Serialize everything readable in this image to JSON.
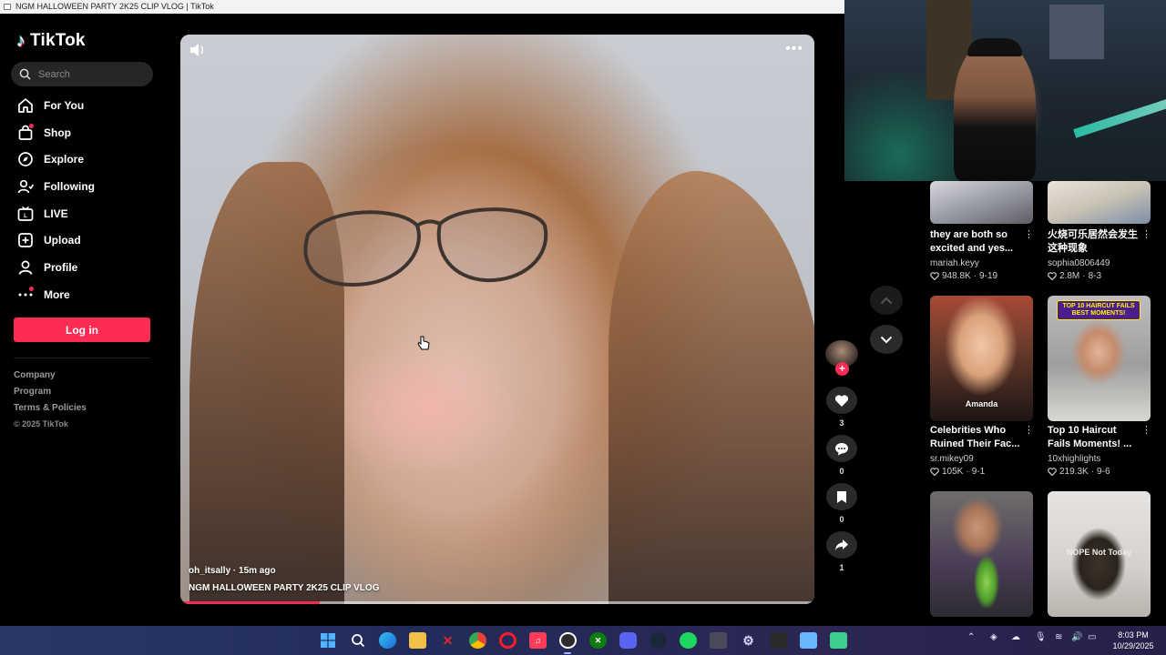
{
  "window": {
    "title": "NGM HALLOWEEN PARTY 2K25 CLIP VLOG | TikTok"
  },
  "brand": {
    "name": "TikTok",
    "accent": "#fe2c55"
  },
  "search": {
    "placeholder": "Search",
    "icon": "search-icon"
  },
  "nav": [
    {
      "label": "For You",
      "icon": "home-icon"
    },
    {
      "label": "Shop",
      "icon": "shop-bag-icon"
    },
    {
      "label": "Explore",
      "icon": "compass-icon"
    },
    {
      "label": "Following",
      "icon": "following-icon"
    },
    {
      "label": "LIVE",
      "icon": "live-icon"
    },
    {
      "label": "Upload",
      "icon": "upload-icon"
    },
    {
      "label": "Profile",
      "icon": "profile-icon"
    },
    {
      "label": "More",
      "icon": "more-dots-icon"
    }
  ],
  "login_label": "Log in",
  "footer": {
    "company": "Company",
    "program": "Program",
    "terms": "Terms & Policies",
    "copyright": "© 2025 TikTok"
  },
  "video": {
    "author_line": "oh_itsally · 15m ago",
    "title": "NGM HALLOWEEN PARTY 2K25 CLIP VLOG",
    "progress": 0.22
  },
  "actions": {
    "likes": "3",
    "comments": "0",
    "saves": "0",
    "shares": "1"
  },
  "recommended": [
    {
      "title": "they are both so excited and yes...",
      "user": "mariah.keyy",
      "views": "948.8K",
      "date": "9-19"
    },
    {
      "title": "火烧可乐居然会发生这种现象",
      "user": "sophia0806449",
      "views": "2.8M",
      "date": "8-3"
    },
    {
      "title": "Celebrities Who Ruined Their Fac...",
      "user": "sr.mikey09",
      "views": "105K",
      "date": "9-1",
      "overlay": "Amanda"
    },
    {
      "title": "Top 10 Haircut Fails Moments! ...",
      "user": "10xhighlights",
      "views": "219.3K",
      "date": "9-6",
      "overlay": "TOP 10 HAIRCUT FAILS BEST MOMENTS!"
    },
    {
      "title": "",
      "user": "",
      "views": "",
      "date": ""
    },
    {
      "title": "",
      "user": "",
      "views": "",
      "date": "",
      "overlay": "NOPE Not Today"
    }
  ],
  "taskbar": {
    "clock_time": "8:03 PM",
    "clock_date": "10/29/2025",
    "apps": [
      "start-icon",
      "search-icon",
      "edge-icon",
      "file-explorer-icon",
      "x-app-icon",
      "chrome-icon",
      "opera-icon",
      "music-icon",
      "obs-icon",
      "xbox-icon",
      "discord-icon",
      "steam-icon",
      "spotify-icon",
      "app-cube-icon",
      "settings-icon",
      "epic-games-icon",
      "notes-icon",
      "chat-app-icon"
    ]
  }
}
